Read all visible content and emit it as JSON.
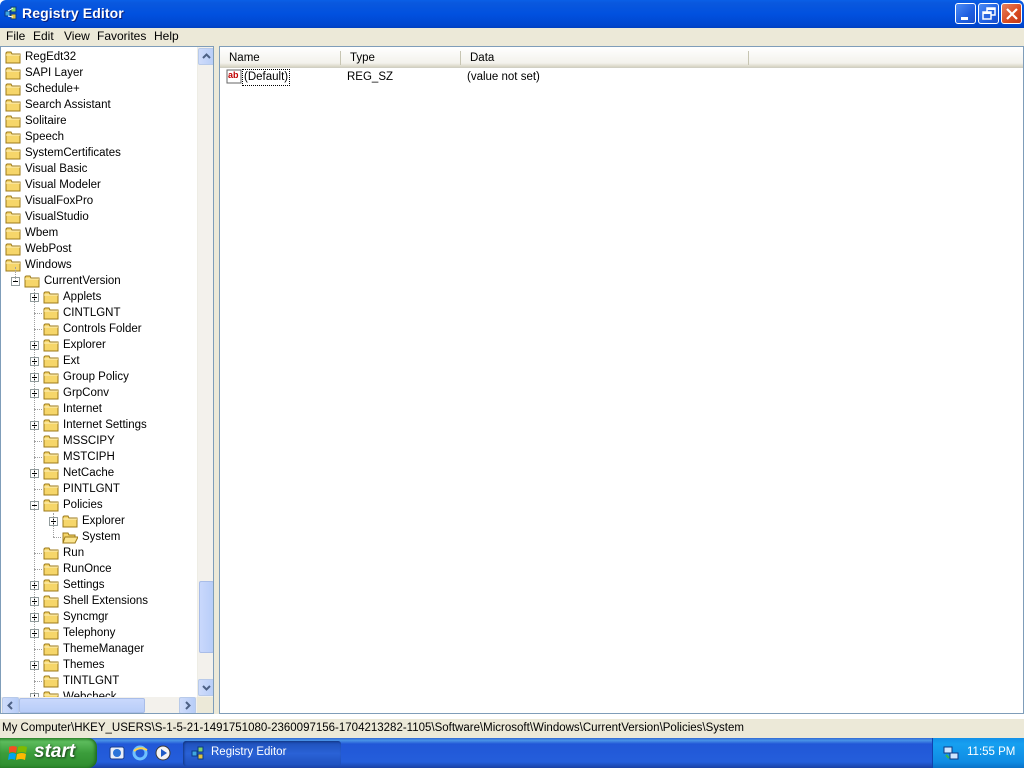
{
  "window": {
    "title": "Registry Editor"
  },
  "menu": [
    "File",
    "Edit",
    "View",
    "Favorites",
    "Help"
  ],
  "tree": {
    "root_items": [
      "RegEdt32",
      "SAPI Layer",
      "Schedule+",
      "Search Assistant",
      "Solitaire",
      "Speech",
      "SystemCertificates",
      "Visual Basic",
      "Visual Modeler",
      "VisualFoxPro",
      "VisualStudio",
      "Wbem",
      "WebPost",
      "Windows"
    ],
    "current_version": "CurrentVersion",
    "cv_children": [
      "Applets",
      "CINTLGNT",
      "Controls Folder",
      "Explorer",
      "Ext",
      "Group Policy",
      "GrpConv",
      "Internet",
      "Internet Settings",
      "MSSCIPY",
      "MSTCIPH",
      "NetCache",
      "PINTLGNT",
      "Policies"
    ],
    "policies_children": [
      "Explorer",
      "System"
    ],
    "cv_children_after": [
      "Run",
      "RunOnce",
      "Settings",
      "Shell Extensions",
      "Syncmgr",
      "Telephony",
      "ThemeManager",
      "Themes",
      "TINTLGNT",
      "Webcheck"
    ],
    "selected": "System"
  },
  "list": {
    "columns": [
      "Name",
      "Type",
      "Data"
    ],
    "rows": [
      {
        "name": "(Default)",
        "type": "REG_SZ",
        "data": "(value not set)"
      }
    ]
  },
  "status": {
    "path": "My Computer\\HKEY_USERS\\S-1-5-21-1491751080-2360097156-1704213282-1105\\Software\\Microsoft\\Windows\\CurrentVersion\\Policies\\System"
  },
  "taskbar": {
    "start_label": "start",
    "task_label": "Registry Editor",
    "clock": "11:55 PM"
  }
}
